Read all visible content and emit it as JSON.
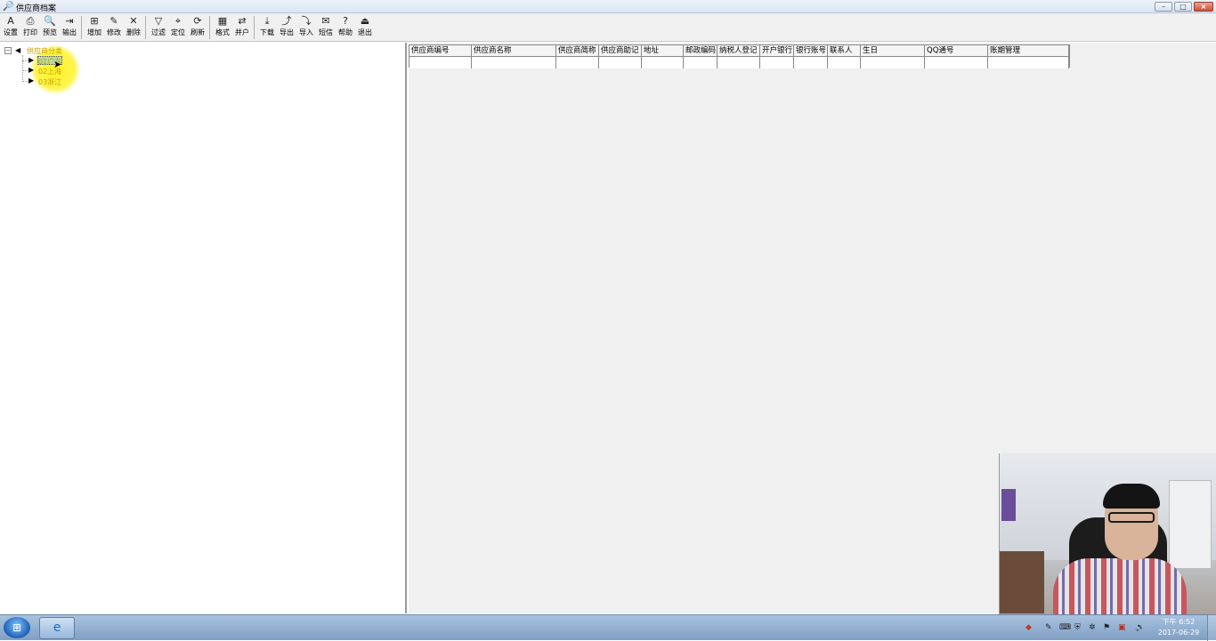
{
  "window": {
    "title": "供应商档案",
    "min": "–",
    "max": "□",
    "close": "×"
  },
  "toolbar": {
    "buttons": [
      {
        "label": "设置",
        "icon": "A"
      },
      {
        "label": "打印",
        "icon": "⎙"
      },
      {
        "label": "预览",
        "icon": "🔍"
      },
      {
        "label": "输出",
        "icon": "⇥"
      },
      {
        "label": "增加",
        "icon": "⊞"
      },
      {
        "label": "修改",
        "icon": "✎"
      },
      {
        "label": "删除",
        "icon": "✕"
      },
      {
        "label": "过滤",
        "icon": "▽"
      },
      {
        "label": "定位",
        "icon": "⌖"
      },
      {
        "label": "刷新",
        "icon": "⟳"
      },
      {
        "label": "格式",
        "icon": "▦"
      },
      {
        "label": "并户",
        "icon": "⇄"
      },
      {
        "label": "下载",
        "icon": "⤓"
      },
      {
        "label": "导出",
        "icon": "⤴"
      },
      {
        "label": "导入",
        "icon": "⤵"
      },
      {
        "label": "短信",
        "icon": "✉"
      },
      {
        "label": "帮助",
        "icon": "?"
      },
      {
        "label": "退出",
        "icon": "⏏"
      }
    ]
  },
  "tree": {
    "root": "供应商分类",
    "children": [
      "01广东",
      "02上海",
      "03浙江"
    ]
  },
  "grid": {
    "columns": [
      "供应商编号",
      "供应商名称",
      "供应商简称",
      "供应商助记",
      "地址",
      "邮政编码",
      "纳税人登记",
      "开户银行",
      "银行账号",
      "联系人",
      "生日",
      "QQ通号",
      "账期管理"
    ]
  },
  "taskbar": {
    "start": "⊞",
    "app": "e",
    "time": "下午 6:52",
    "date": "2017-06-29"
  }
}
